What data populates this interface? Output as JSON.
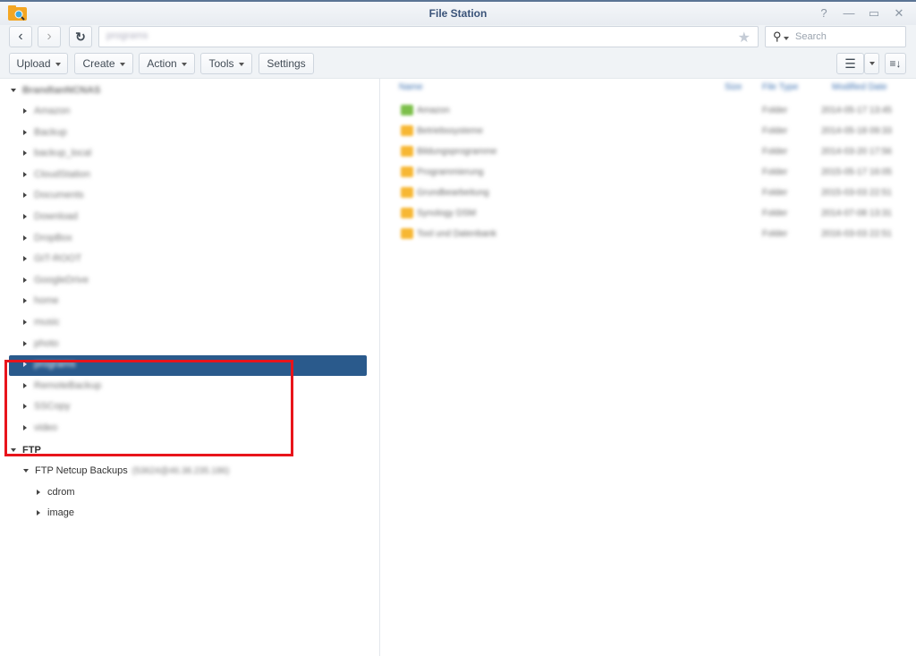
{
  "window": {
    "title": "File Station",
    "controls": {
      "help": "?",
      "minimize": "—",
      "maximize": "▭",
      "close": "✕"
    }
  },
  "nav": {
    "back": "‹",
    "forward": "›",
    "refresh": "↻",
    "path_value": "programs",
    "bookmark": "★"
  },
  "search": {
    "placeholder": "Search"
  },
  "toolbar": {
    "upload": "Upload",
    "create": "Create",
    "action": "Action",
    "tools": "Tools",
    "settings": "Settings"
  },
  "tree": {
    "root": "BrandtanNCNAS",
    "folders": [
      "Amazon",
      "Backup",
      "backup_local",
      "CloudStation",
      "Documents",
      "Download",
      "DropBox",
      "GIT-ROOT",
      "GoogleDrive",
      "home",
      "music",
      "photo",
      "programs",
      "RemoteBackup",
      "SSCopy",
      "video"
    ],
    "selected": "programs",
    "ftp": {
      "label": "FTP",
      "connection": "FTP Netcup Backups",
      "connection_detail": "(53624@46.38.235.186)",
      "children": [
        "cdrom",
        "image"
      ]
    }
  },
  "filelist": {
    "columns": [
      "Name",
      "Size",
      "File Type",
      "Modified Date"
    ],
    "rows": [
      {
        "name": "Amazon",
        "type": "Folder",
        "date": "2014-05-17 13:45",
        "color": "#7cbf4a"
      },
      {
        "name": "Betriebssysteme",
        "type": "Folder",
        "date": "2014-05-18 09:33",
        "color": "#f7b733"
      },
      {
        "name": "Bildungsprogramme",
        "type": "Folder",
        "date": "2014-03-20 17:56",
        "color": "#f7b733"
      },
      {
        "name": "Programmierung",
        "type": "Folder",
        "date": "2015-05-17 16:05",
        "color": "#f7b733"
      },
      {
        "name": "Grundbearbeitung",
        "type": "Folder",
        "date": "2015-03-03 22:51",
        "color": "#f7b733"
      },
      {
        "name": "Synology DSM",
        "type": "Folder",
        "date": "2014-07-08 13:31",
        "color": "#f7b733"
      },
      {
        "name": "Tool und Datenbank",
        "type": "Folder",
        "date": "2016-03-03 22:51",
        "color": "#f7b733"
      }
    ]
  }
}
